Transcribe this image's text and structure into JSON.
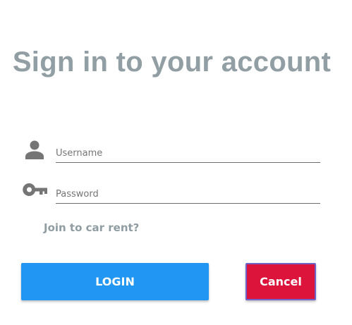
{
  "page": {
    "title": "Sign in to your account"
  },
  "form": {
    "username": {
      "icon": "user-icon",
      "placeholder": "Username",
      "value": ""
    },
    "password": {
      "icon": "key-icon",
      "placeholder": "Password",
      "value": ""
    },
    "join_link": "Join to car rent?"
  },
  "actions": {
    "login_label": "LOGIN",
    "cancel_label": "Cancel"
  },
  "colors": {
    "title": "#919ea4",
    "icon": "#757575",
    "link": "#8f9ca2",
    "login_button": "#2196f3",
    "cancel_button": "#dc143c",
    "cancel_border": "#6f63c9"
  }
}
